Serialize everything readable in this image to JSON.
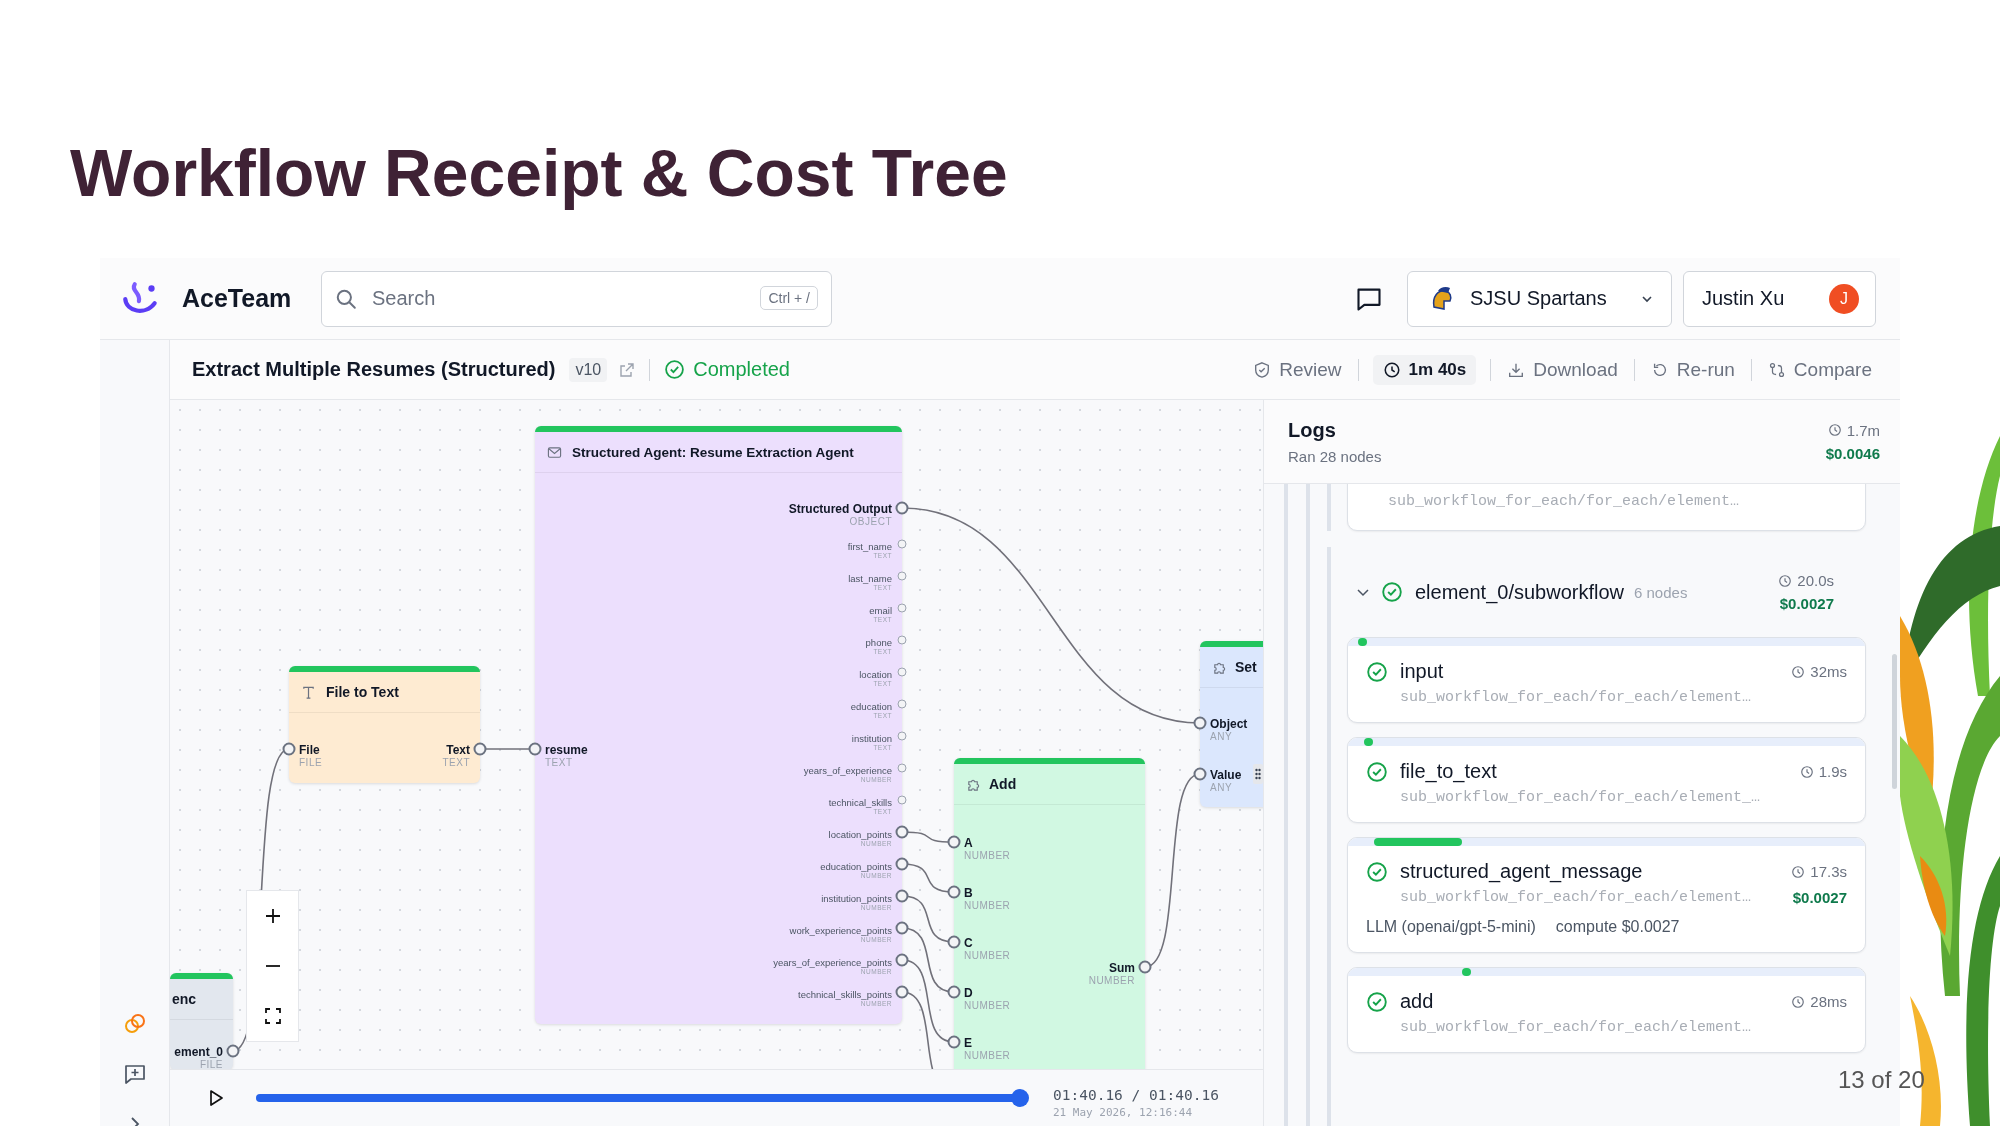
{
  "slide": {
    "title": "Workflow Receipt & Cost Tree",
    "page": "13 of 20"
  },
  "header": {
    "brand": "AceTeam",
    "search": {
      "placeholder": "Search",
      "shortcut": "Ctrl + /"
    },
    "org": "SJSU Spartans",
    "user": {
      "name": "Justin Xu",
      "initial": "J"
    }
  },
  "run": {
    "title": "Extract Multiple Resumes (Structured)",
    "version": "v10",
    "status": {
      "label": "Completed",
      "kind": "success"
    },
    "actions": [
      {
        "kind": "review",
        "label": "Review"
      },
      {
        "kind": "duration",
        "label": "1m 40s"
      },
      {
        "kind": "download",
        "label": "Download"
      },
      {
        "kind": "rerun",
        "label": "Re-run"
      },
      {
        "kind": "compare",
        "label": "Compare"
      }
    ]
  },
  "canvas": {
    "nodes": [
      {
        "kind": "input",
        "title": "enc",
        "color": "#e2e7ee",
        "outputs": [
          {
            "name": "ement_0",
            "type": "FILE",
            "primary": true,
            "connected": true
          }
        ]
      },
      {
        "kind": "converter",
        "title": "File to Text",
        "color": "#feebd2",
        "inputs": [
          {
            "name": "File",
            "type": "FILE",
            "primary": true,
            "connected": true
          }
        ],
        "outputs": [
          {
            "name": "Text",
            "type": "TEXT",
            "primary": true,
            "connected": true
          }
        ]
      },
      {
        "kind": "agent",
        "title": "Structured Agent: Resume Extraction Agent",
        "color": "#ecdffd",
        "inputs": [
          {
            "name": "resume",
            "type": "TEXT",
            "primary": true,
            "connected": true
          }
        ],
        "outputs": [
          {
            "name": "Structured Output",
            "type": "OBJECT",
            "primary": true,
            "connected": true
          },
          {
            "name": "first_name",
            "type": "TEXT",
            "primary": false,
            "connected": false
          },
          {
            "name": "last_name",
            "type": "TEXT",
            "primary": false,
            "connected": false
          },
          {
            "name": "email",
            "type": "TEXT",
            "primary": false,
            "connected": false
          },
          {
            "name": "phone",
            "type": "TEXT",
            "primary": false,
            "connected": false
          },
          {
            "name": "location",
            "type": "TEXT",
            "primary": false,
            "connected": false
          },
          {
            "name": "education",
            "type": "TEXT",
            "primary": false,
            "connected": false
          },
          {
            "name": "institution",
            "type": "TEXT",
            "primary": false,
            "connected": false
          },
          {
            "name": "years_of_experience",
            "type": "NUMBER",
            "primary": false,
            "connected": false
          },
          {
            "name": "technical_skills",
            "type": "TEXT",
            "primary": false,
            "connected": false
          },
          {
            "name": "location_points",
            "type": "NUMBER",
            "primary": false,
            "connected": true
          },
          {
            "name": "education_points",
            "type": "NUMBER",
            "primary": false,
            "connected": true
          },
          {
            "name": "institution_points",
            "type": "NUMBER",
            "primary": false,
            "connected": true
          },
          {
            "name": "work_experience_points",
            "type": "NUMBER",
            "primary": false,
            "connected": true
          },
          {
            "name": "years_of_experience_points",
            "type": "NUMBER",
            "primary": false,
            "connected": true
          },
          {
            "name": "technical_skills_points",
            "type": "NUMBER",
            "primary": false,
            "connected": true
          }
        ]
      },
      {
        "kind": "function",
        "title": "Add",
        "color": "#d1f8e2",
        "inputs": [
          {
            "name": "A",
            "type": "NUMBER",
            "primary": true,
            "connected": true
          },
          {
            "name": "B",
            "type": "NUMBER",
            "primary": true,
            "connected": true
          },
          {
            "name": "C",
            "type": "NUMBER",
            "primary": true,
            "connected": true
          },
          {
            "name": "D",
            "type": "NUMBER",
            "primary": true,
            "connected": true
          },
          {
            "name": "E",
            "type": "NUMBER",
            "primary": true,
            "connected": true
          }
        ],
        "outputs": [
          {
            "name": "Sum",
            "type": "NUMBER",
            "primary": true,
            "connected": true
          }
        ]
      },
      {
        "kind": "function",
        "title": "Set",
        "color": "#dbe7fd",
        "inputs": [
          {
            "name": "Object",
            "type": "ANY",
            "primary": true,
            "connected": true
          },
          {
            "name": "Value",
            "type": "ANY",
            "primary": true,
            "connected": true
          }
        ]
      }
    ]
  },
  "player": {
    "level": 1,
    "time": "01:40.16 / 01:40.16",
    "date": "21 May 2026, 12:16:44"
  },
  "logs": {
    "title": "Logs",
    "subtitle": "Ran 28 nodes",
    "duration": "1.7m",
    "cost": "$0.0046",
    "top_card": {
      "path": "sub_workflow_for_each/for_each/element…"
    },
    "group": {
      "name": "element_0/subworkflow",
      "count": "6 nodes",
      "duration": "20.0s",
      "cost": "$0.0027",
      "expanded": true
    },
    "items": [
      {
        "name": "input",
        "duration": "32ms",
        "path": "sub_workflow_for_each/for_each/element…"
      },
      {
        "name": "file_to_text",
        "duration": "1.9s",
        "path": "sub_workflow_for_each/for_each/element_…"
      },
      {
        "name": "structured_agent_message",
        "duration": "17.3s",
        "path": "sub_workflow_for_each/for_each/element…",
        "cost": "$0.0027",
        "model": "LLM (openai/gpt-5-mini)",
        "compute": "compute $0.0027"
      },
      {
        "name": "add",
        "duration": "28ms",
        "path": "sub_workflow_for_each/for_each/element…"
      }
    ]
  }
}
